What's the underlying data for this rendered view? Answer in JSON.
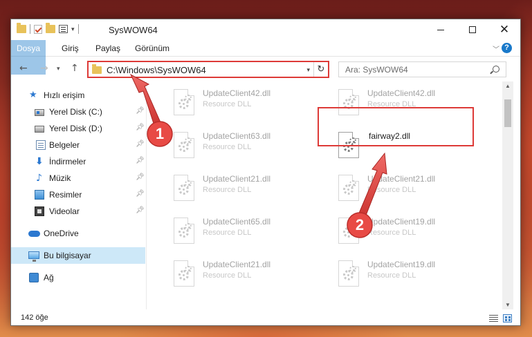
{
  "window": {
    "title": "SysWOW64",
    "controls": {
      "minimize": "minimize",
      "maximize": "maximize",
      "close": "✕"
    }
  },
  "ribbon": {
    "tabs": {
      "file": "Dosya",
      "home": "Giriş",
      "share": "Paylaş",
      "view": "Görünüm"
    },
    "help": "?"
  },
  "navigation": {
    "address": "C:\\Windows\\SysWOW64",
    "search_placeholder": "Ara: SysWOW64"
  },
  "sidebar": {
    "quick_access": "Hızlı erişim",
    "items": [
      {
        "label": "Yerel Disk (C:)",
        "icon": "drive-icon",
        "pinned": true
      },
      {
        "label": "Yerel Disk (D:)",
        "icon": "drive-icon",
        "pinned": true
      },
      {
        "label": "Belgeler",
        "icon": "documents-icon",
        "pinned": true
      },
      {
        "label": "İndirmeler",
        "icon": "downloads-icon",
        "pinned": true
      },
      {
        "label": "Müzik",
        "icon": "music-icon",
        "pinned": true
      },
      {
        "label": "Resimler",
        "icon": "pictures-icon",
        "pinned": true
      },
      {
        "label": "Videolar",
        "icon": "videos-icon",
        "pinned": true
      }
    ],
    "onedrive": "OneDrive",
    "this_pc": "Bu bilgisayar",
    "network": "Ağ"
  },
  "files": {
    "left_column": [
      {
        "name": "UpdateClient42.dll",
        "type": "Resource DLL"
      },
      {
        "name": "UpdateClient63.dll",
        "type": "Resource DLL"
      },
      {
        "name": "UpdateClient21.dll",
        "type": "Resource DLL"
      },
      {
        "name": "UpdateClient65.dll",
        "type": "Resource DLL"
      },
      {
        "name": "UpdateClient21.dll",
        "type": "Resource DLL"
      }
    ],
    "right_column": [
      {
        "name": "UpdateClient42.dll",
        "type": "Resource DLL"
      },
      {
        "name": "fairway2.dll",
        "type": ""
      },
      {
        "name": "UpdateClient21.dll",
        "type": "Resource DLL"
      },
      {
        "name": "UpdateClient19.dll",
        "type": "Resource DLL"
      },
      {
        "name": "UpdateClient19.dll",
        "type": "Resource DLL"
      }
    ]
  },
  "status": {
    "item_count": "142 öğe"
  },
  "annotations": {
    "step1": "1",
    "step2": "2",
    "color": "#dd3a37"
  }
}
